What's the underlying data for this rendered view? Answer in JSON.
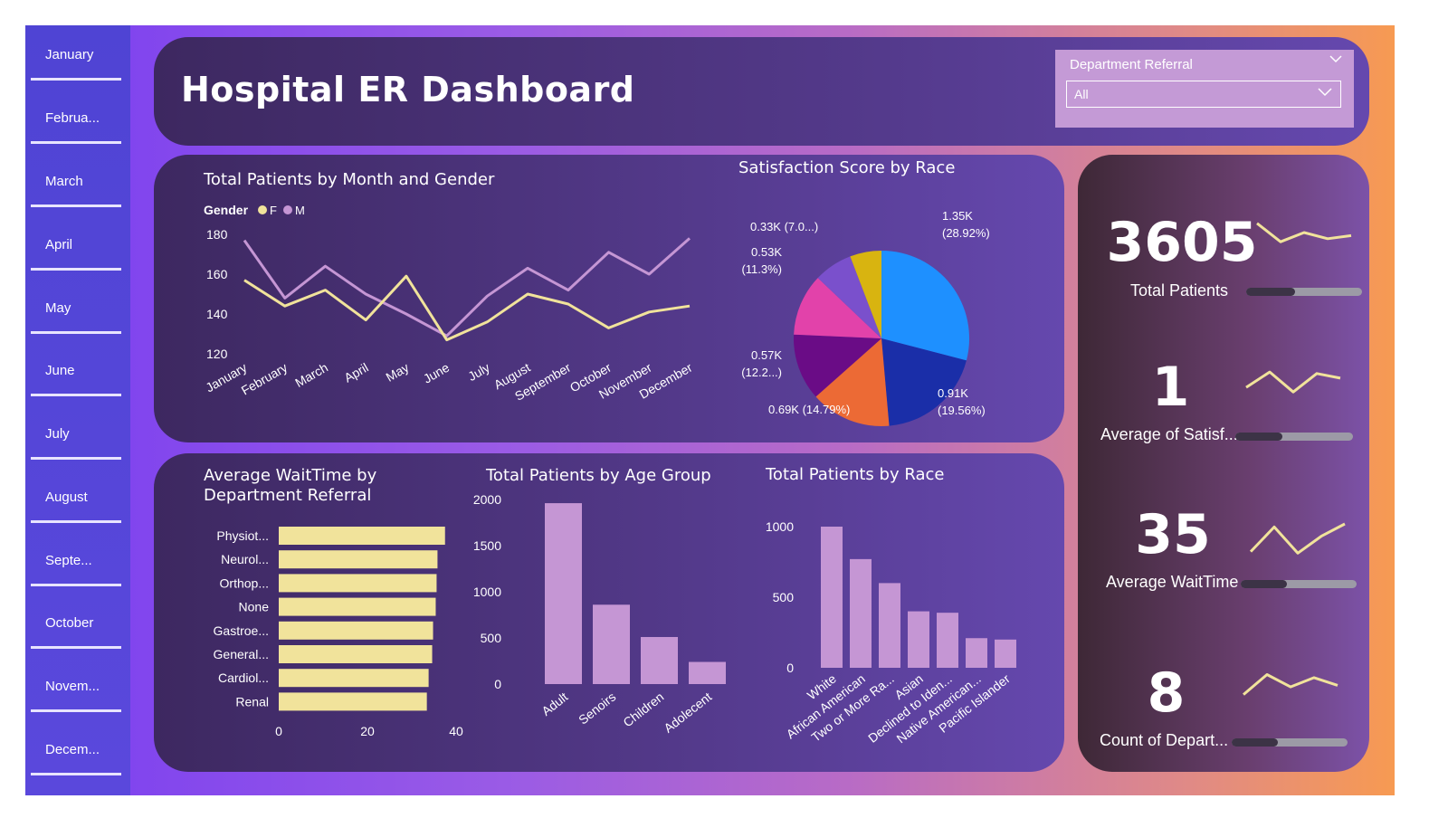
{
  "months": [
    "January",
    "Februa...",
    "March",
    "April",
    "May",
    "June",
    "July",
    "August",
    "Septe...",
    "October",
    "Novem...",
    "Decem..."
  ],
  "header": {
    "title": "Hospital ER Dashboard"
  },
  "slicer": {
    "title": "Department Referral",
    "value": "All"
  },
  "line_chart": {
    "title": "Total Patients by Month and Gender",
    "legend_title": "Gender",
    "legend": [
      "F",
      "M"
    ],
    "colors": {
      "F": "#f1e39b",
      "M": "#c596d4"
    }
  },
  "pie_chart": {
    "title": "Satisfaction Score by Race",
    "labels": [
      "1.35K\n(28.92%)",
      "0.91K\n(19.56%)",
      "0.69K (14.79%)",
      "0.57K\n(12.2...)",
      "0.53K\n(11.3%)",
      "0.33K (7.0...)"
    ]
  },
  "wait_chart": {
    "title_line1": "Average WaitTime by",
    "title_line2": "Department Referral"
  },
  "age_chart": {
    "title": "Total Patients by Age Group"
  },
  "race_chart": {
    "title": "Total Patients by Race"
  },
  "kpis": [
    {
      "value": "3605",
      "label": "Total Patients",
      "bar": 0.42,
      "trend": [
        0.8,
        0.2,
        0.5,
        0.3,
        0.4
      ]
    },
    {
      "value": "1",
      "label": "Average of Satisf...",
      "bar": 0.4,
      "trend": [
        0.35,
        0.85,
        0.2,
        0.8,
        0.65
      ]
    },
    {
      "value": "35",
      "label": "Average WaitTime",
      "bar": 0.4,
      "trend": [
        0.1,
        0.9,
        0.05,
        0.6,
        1.0
      ]
    },
    {
      "value": "8",
      "label": "Count of Depart...",
      "bar": 0.4,
      "trend": [
        0.1,
        0.75,
        0.35,
        0.65,
        0.4
      ]
    }
  ],
  "chart_data": [
    {
      "type": "line",
      "title": "Total Patients by Month and Gender",
      "x": [
        "January",
        "February",
        "March",
        "April",
        "May",
        "June",
        "July",
        "August",
        "September",
        "October",
        "November",
        "December"
      ],
      "ylim": [
        120,
        180
      ],
      "yticks": [
        120,
        140,
        160,
        180
      ],
      "legend_title": "Gender",
      "legend_placement": "top-left",
      "series": [
        {
          "name": "F",
          "color": "#f1e39b",
          "values": [
            157,
            144,
            152,
            137,
            159,
            127,
            136,
            150,
            145,
            133,
            141,
            144
          ]
        },
        {
          "name": "M",
          "color": "#c596d4",
          "values": [
            177,
            148,
            164,
            150,
            140,
            129,
            149,
            163,
            152,
            171,
            160,
            178
          ]
        }
      ]
    },
    {
      "type": "pie",
      "title": "Satisfaction Score by Race",
      "slices": [
        {
          "value": 1.35,
          "percent": 28.92,
          "color": "#1e90ff"
        },
        {
          "value": 0.91,
          "percent": 19.56,
          "color": "#1a2ea8"
        },
        {
          "value": 0.69,
          "percent": 14.79,
          "color": "#ec6a35"
        },
        {
          "value": 0.57,
          "percent": 12.2,
          "color": "#6a0c86"
        },
        {
          "value": 0.53,
          "percent": 11.3,
          "color": "#e242aa"
        },
        {
          "value": 0.33,
          "percent": 7.0,
          "color": "#7a50cc"
        },
        {
          "value": 0.27,
          "percent": 5.9,
          "color": "#d8b410"
        }
      ]
    },
    {
      "type": "bar",
      "orientation": "horizontal",
      "title": "Average WaitTime by Department Referral",
      "categories": [
        "Physiot...",
        "Neurol...",
        "Orthop...",
        "None",
        "Gastroe...",
        "General...",
        "Cardiol...",
        "Renal"
      ],
      "values": [
        37.5,
        35.8,
        35.6,
        35.4,
        34.8,
        34.6,
        33.8,
        33.4
      ],
      "xlim": [
        0,
        40
      ],
      "xticks": [
        0,
        20,
        40
      ],
      "color": "#f1e39b"
    },
    {
      "type": "bar",
      "title": "Total Patients by Age Group",
      "categories": [
        "Adult",
        "Senoirs",
        "Children",
        "Adolecent"
      ],
      "values": [
        1960,
        860,
        510,
        240
      ],
      "ylim": [
        0,
        2000
      ],
      "yticks": [
        0,
        500,
        1000,
        1500,
        2000
      ],
      "color": "#c596d4"
    },
    {
      "type": "bar",
      "title": "Total Patients by Race",
      "categories": [
        "White",
        "African American",
        "Two or More Ra...",
        "Asian",
        "Declined to Iden...",
        "Native American...",
        "Pacific Islander"
      ],
      "values": [
        1000,
        770,
        600,
        400,
        390,
        210,
        200
      ],
      "ylim": [
        0,
        1000
      ],
      "yticks": [
        0,
        500,
        1000
      ],
      "color": "#c596d4"
    }
  ]
}
